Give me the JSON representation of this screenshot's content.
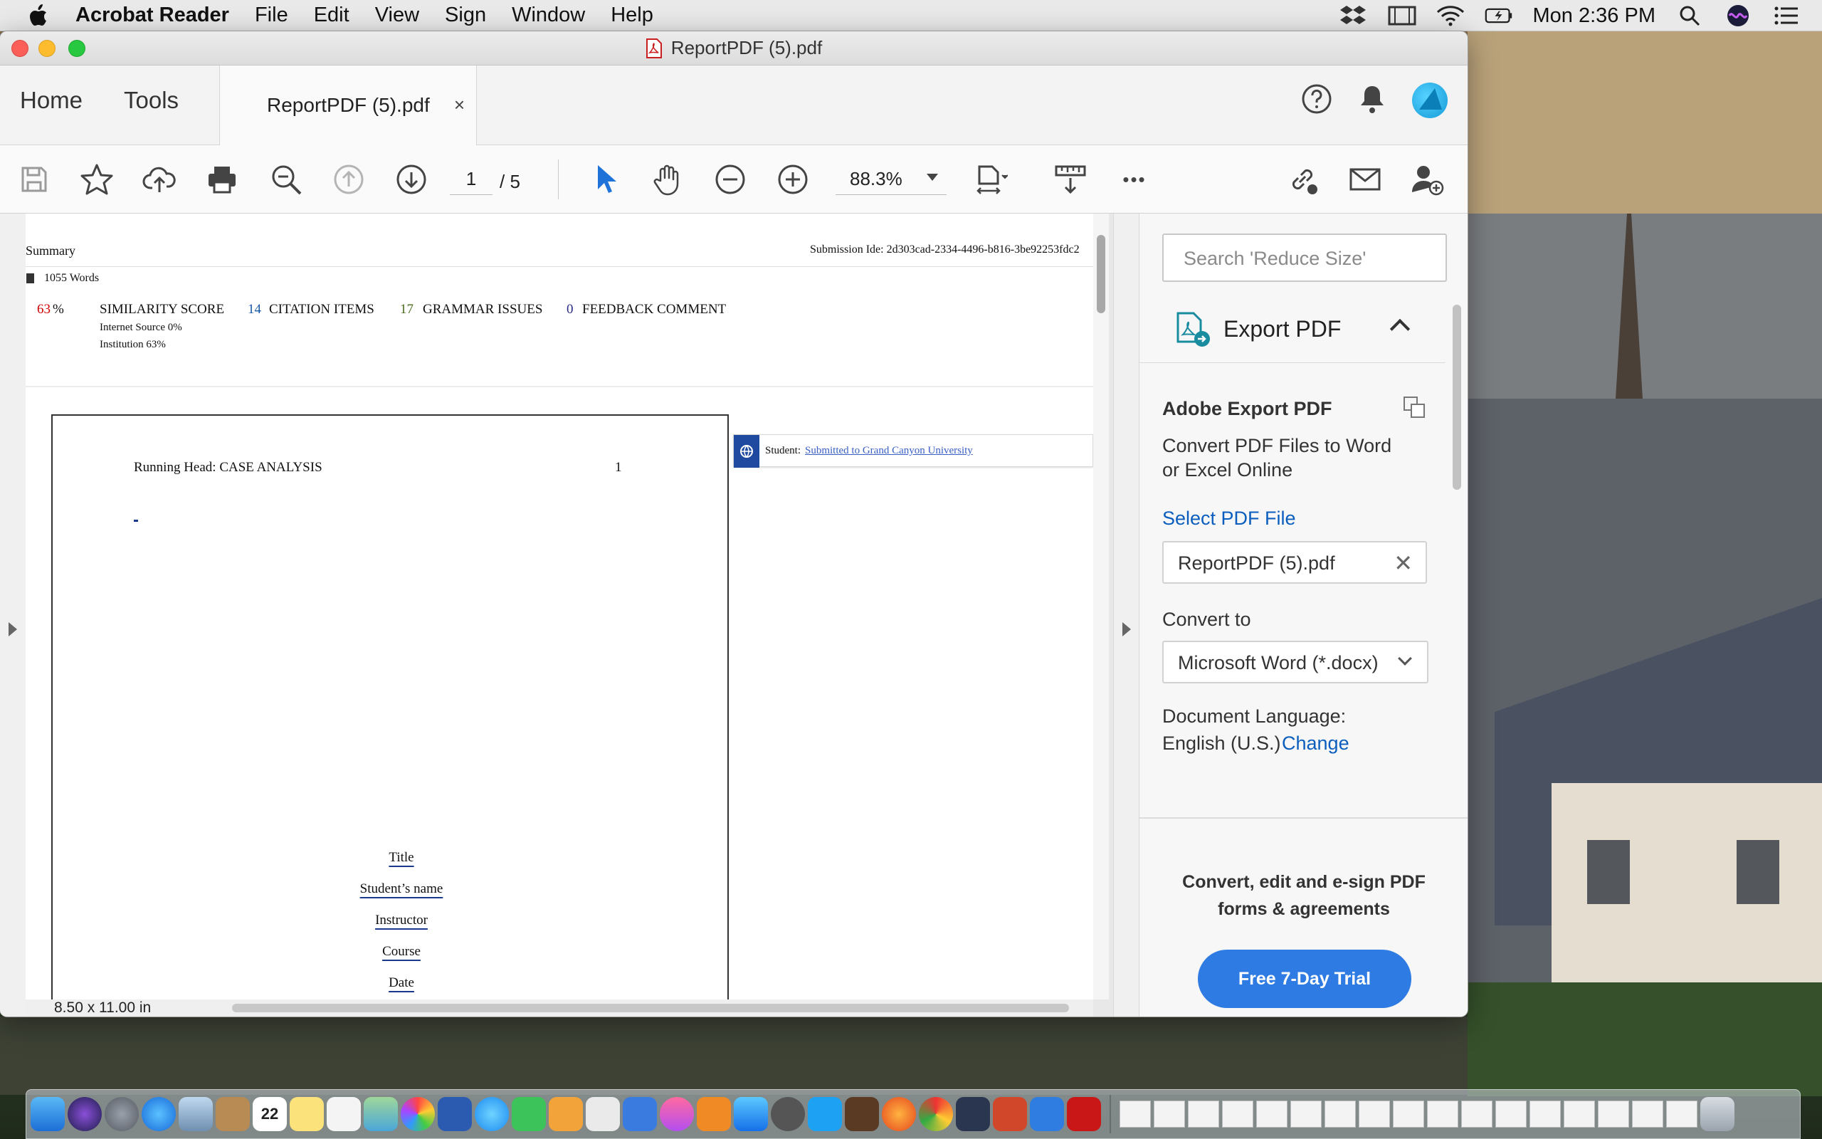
{
  "menubar": {
    "app_name": "Acrobat Reader",
    "items": [
      "File",
      "Edit",
      "View",
      "Sign",
      "Window",
      "Help"
    ],
    "clock": "Mon 2:36 PM"
  },
  "window": {
    "title": "ReportPDF (5).pdf"
  },
  "tabs": {
    "home": "Home",
    "tools": "Tools",
    "document": "ReportPDF (5).pdf",
    "close_glyph": "×"
  },
  "toolbar": {
    "page_current": "1",
    "page_total": "/ 5",
    "zoom": "88.3%",
    "more_glyph": "•••"
  },
  "document": {
    "summary_label": "Summary",
    "submission_id": "Submission Ide: 2d303cad-2334-4496-b816-3be92253fdc2",
    "word_count": "1055 Words",
    "similarity_pct": "63",
    "similarity_pct_sign": "%",
    "similarity_label": "SIMILARITY SCORE",
    "internet_source": "Internet Source   0%",
    "institution": "Institution   63%",
    "citation_count": "14",
    "citation_label": "CITATION ITEMS",
    "grammar_count": "17",
    "grammar_label": "GRAMMAR ISSUES",
    "feedback_count": "0",
    "feedback_label": "FEEDBACK COMMENT",
    "running_head": "Running Head: CASE ANALYSIS",
    "page_number": "1",
    "title_lines": [
      "Title",
      "Student’s name",
      "Instructor",
      "Course",
      "Date"
    ],
    "source_label": "Student:",
    "source_link": "Submitted to Grand Canyon University"
  },
  "statusbar": {
    "page_size": "8.50 x 11.00 in"
  },
  "right_pane": {
    "search_placeholder": "Search 'Reduce Size'",
    "section_title": "Export PDF",
    "heading": "Adobe Export PDF",
    "description_1": "Convert PDF Files to Word",
    "description_2": "or Excel Online",
    "select_file_link": "Select PDF File",
    "selected_file": "ReportPDF (5).pdf",
    "clear_glyph": "✕",
    "convert_to_label": "Convert to",
    "convert_to_value": "Microsoft Word (*.docx)",
    "doc_language_label": "Document Language:",
    "doc_language_value": "English (U.S.)",
    "change_link": "Change",
    "promo_1": "Convert, edit and e-sign PDF",
    "promo_2": "forms & agreements",
    "trial_button": "Free 7-Day Trial"
  },
  "dock": {
    "calendar_day": "22"
  },
  "colors": {
    "accent_blue": "#2e7be3",
    "link_blue": "#0b5ebd",
    "similarity_red": "#d00000",
    "citation_blue": "#1a5aa8",
    "grammar_green": "#4b6b1c",
    "feedback_navy": "#2a2a8c"
  }
}
